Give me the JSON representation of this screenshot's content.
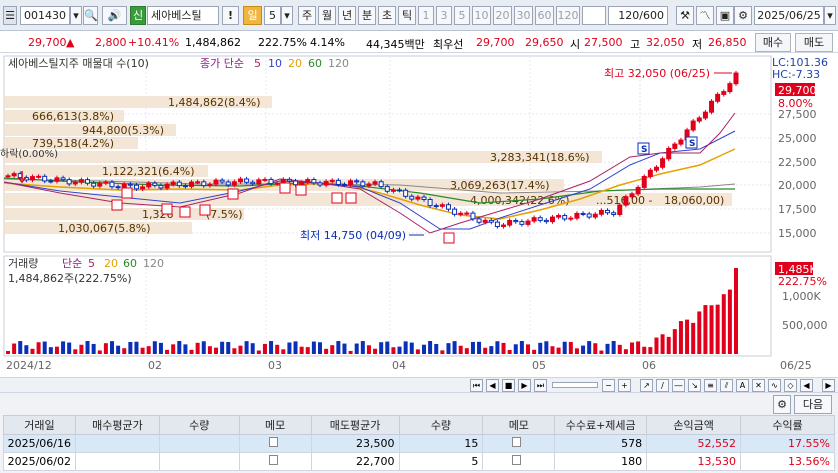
{
  "toolbar": {
    "code": "001430",
    "tag": "신",
    "stock_name": "세아베스틸",
    "period_unit": "일",
    "period_value": "5",
    "periods": [
      "주",
      "월",
      "년",
      "분",
      "초",
      "틱"
    ],
    "minutes": [
      "1",
      "3",
      "5",
      "10",
      "20",
      "30",
      "60",
      "120"
    ],
    "count": "120/600",
    "date": "2025/06/25"
  },
  "pricebar": {
    "price": "29,700",
    "change": "2,800",
    "change_pct": "+10.41%",
    "volume": "1,484,862",
    "vol_ratio": "222.75%",
    "turnover": "4.14%",
    "amount": "44,345백만",
    "best_ask_label": "최우선",
    "ask": "29,700",
    "bid": "29,650",
    "open_label": "시",
    "open": "27,500",
    "high_label": "고",
    "high": "32,050",
    "low_label": "저",
    "low": "26,850",
    "buy_btn": "매수",
    "sell_btn": "매도"
  },
  "chart": {
    "title": "세아베스틸지주 매물대 수(10)",
    "ma_label": "종가 단순",
    "ma_periods": [
      "5",
      "10",
      "20",
      "60",
      "120"
    ],
    "lc": "LC:101.36",
    "hc": "HC:-7.33",
    "high_note": "최고 32,050 (06/25)",
    "low_note": "최저 14,750 (04/09)",
    "down_note": "하락(0.00%)",
    "price_tag": "29,700",
    "pct_tag": "8.00%",
    "y_ticks": [
      "27,500",
      "25,000",
      "22,500",
      "20,000",
      "17,500",
      "15,000"
    ],
    "vol_title": "거래량",
    "vol_ma_label": "단순",
    "vol_ma_periods": [
      "5",
      "20",
      "60",
      "120"
    ],
    "vol_note": "1,484,862주(222.75%)",
    "vol_tag": "1,485K",
    "vol_pct_tag": "222.75%",
    "vol_ticks": [
      "1,000K",
      "500,000"
    ],
    "x_ticks": [
      "2024/12",
      "02",
      "03",
      "04",
      "05",
      "06",
      "06/25"
    ],
    "profile_labels": [
      "1,484,862(8.4%)",
      "666,613(3.8%)",
      "944,800(5.3%)",
      "739,518(4.2%)",
      "3,283,341(18.6%)",
      "1,122,321(6.4%)",
      "3,069,263(17.4%)",
      "4,000,342(22.6%)",
      "18,060,00)",
      "1,326",
      "(7.5%)",
      "1,030,067(5.8%)",
      "...516,00 -"
    ]
  },
  "chart_data": {
    "type": "line",
    "title": "세아베스틸지주 매물대 수(10)",
    "xlabel": "",
    "ylabel": "",
    "x": [
      "2024/12",
      "02",
      "03",
      "04",
      "05",
      "06",
      "06/25"
    ],
    "series": [
      {
        "name": "종가",
        "values": [
          20500,
          19500,
          20000,
          19800,
          16000,
          17200,
          29700
        ]
      }
    ],
    "ylim": [
      13500,
      31500
    ],
    "annotations": [
      "최고 32,050 (06/25)",
      "최저 14,750 (04/09)"
    ]
  },
  "trade": {
    "next_btn": "다음",
    "headers": [
      "거래일",
      "매수평균가",
      "수량",
      "메모",
      "매도평균가",
      "수량",
      "메모",
      "수수료+제세금",
      "손익금액",
      "수익률"
    ],
    "rows": [
      {
        "date": "2025/06/16",
        "buy_avg": "",
        "buy_qty": "",
        "sell_avg": "23,500",
        "sell_qty": "15",
        "fee": "578",
        "pnl": "52,552",
        "ret": "17.55%"
      },
      {
        "date": "2025/06/02",
        "buy_avg": "",
        "buy_qty": "",
        "sell_avg": "22,700",
        "sell_qty": "5",
        "fee": "180",
        "pnl": "13,530",
        "ret": "13.56%"
      }
    ]
  }
}
